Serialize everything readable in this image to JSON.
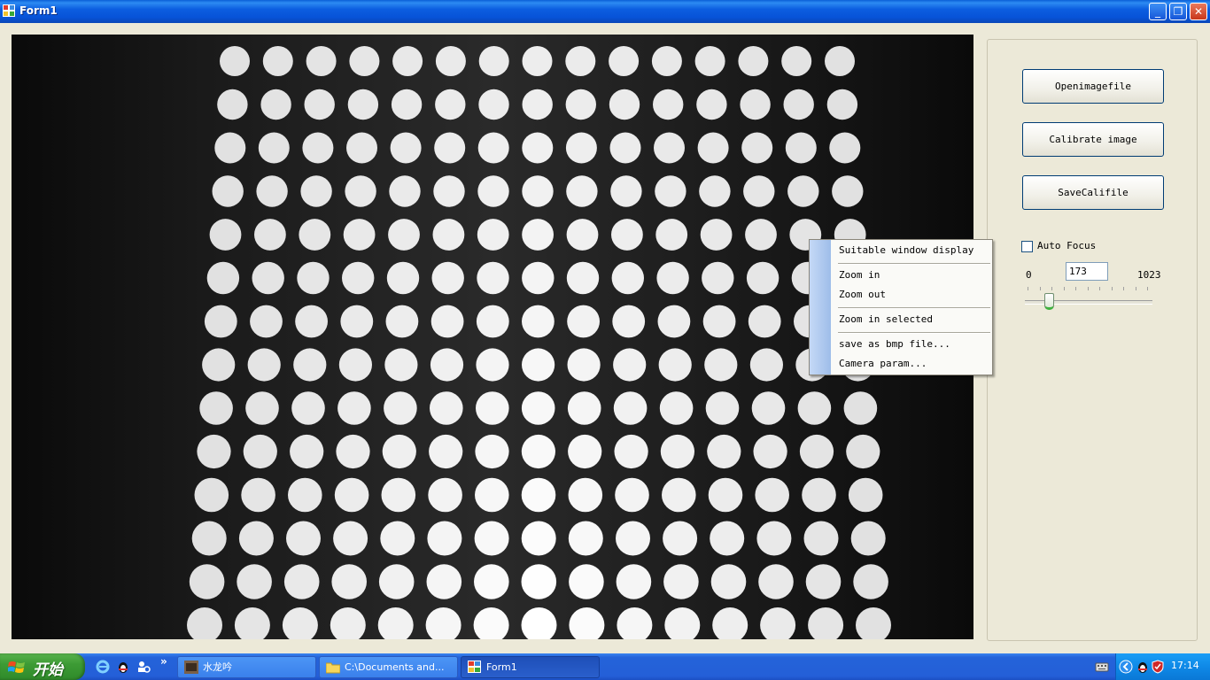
{
  "window": {
    "title": "Form1",
    "controls": {
      "minimize": "_",
      "restore": "❐",
      "close": "✕"
    }
  },
  "image_view": {
    "description_icon": "image-panel",
    "grid_rows": 14,
    "grid_cols": 15
  },
  "buttons": {
    "open": "Openimagefile",
    "calibrate": "Calibrate image",
    "save": "SaveCalifile"
  },
  "autofocus": {
    "label": "Auto Focus",
    "checked": false
  },
  "slider": {
    "min_label": "0",
    "max_label": "1023",
    "value": "173",
    "min": 0,
    "max": 1023
  },
  "context_menu": {
    "items": [
      "Suitable window display",
      "Zoom in",
      "Zoom out",
      "Zoom in selected",
      "save as bmp file...",
      "Camera param..."
    ]
  },
  "taskbar": {
    "start_label": "开始",
    "tasks": [
      {
        "label": "水龙吟",
        "icon": "image-icon",
        "active": false
      },
      {
        "label": "C:\\Documents and...",
        "icon": "folder-icon",
        "active": false
      },
      {
        "label": "Form1",
        "icon": "app-icon",
        "active": true
      }
    ],
    "clock": "17:14",
    "overflow_label": "»"
  },
  "colors": {
    "title_bar": "#0753d8",
    "taskbar": "#245fd8",
    "start_button": "#3d9b35",
    "tray": "#0f89e7"
  }
}
